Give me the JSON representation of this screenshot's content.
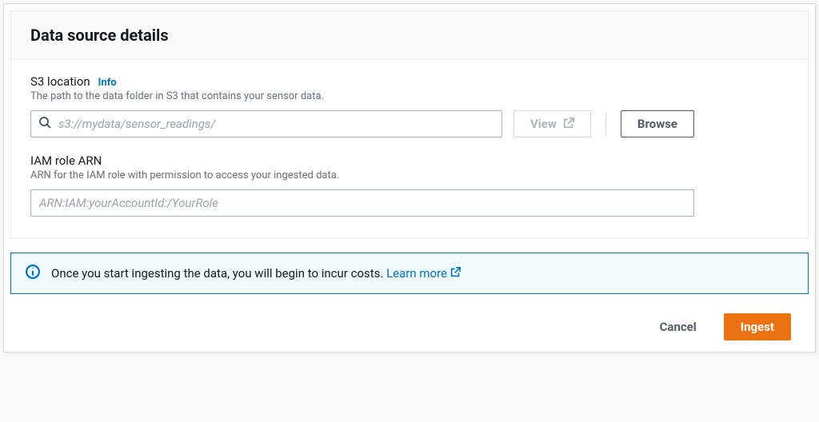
{
  "panel": {
    "title": "Data source details"
  },
  "s3": {
    "label": "S3 location",
    "info": "Info",
    "hint": "The path to the data folder in S3 that contains your sensor data.",
    "placeholder": "s3://mydata/sensor_readings/",
    "value": "",
    "view_label": "View",
    "browse_label": "Browse"
  },
  "iam": {
    "label": "IAM role ARN",
    "hint": "ARN for the IAM role with permission to access your ingested data.",
    "placeholder": "ARN:IAM:yourAccountId:/YourRole",
    "value": ""
  },
  "alert": {
    "text": "Once you start ingesting the data, you will begin to incur costs.",
    "learn_more": "Learn more"
  },
  "actions": {
    "cancel": "Cancel",
    "ingest": "Ingest"
  }
}
